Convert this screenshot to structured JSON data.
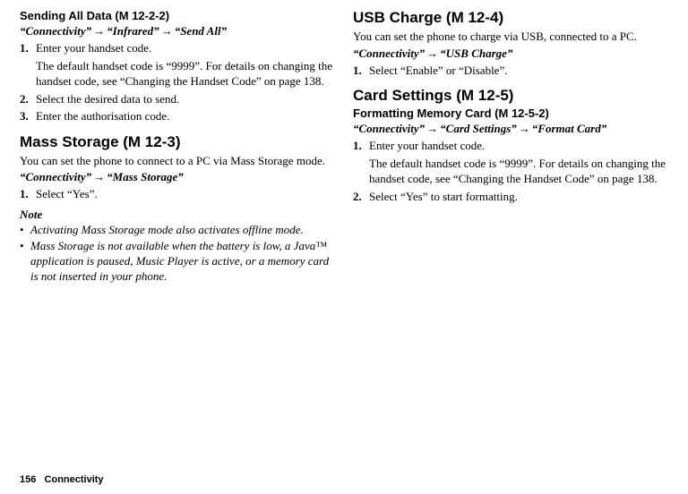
{
  "left": {
    "sec1": {
      "heading": "Sending All Data (M 12-2-2)",
      "nav_parts": [
        "“Connectivity”",
        "“Infrared”",
        "“Send All”"
      ],
      "step1_num": "1.",
      "step1_text": "Enter your handset code.",
      "step1_detail": "The default handset code is “9999”. For details on changing the handset code, see “Changing the Handset Code” on page 138.",
      "step2_num": "2.",
      "step2_text": "Select the desired data to send.",
      "step3_num": "3.",
      "step3_text": "Enter the authorisation code."
    },
    "sec2": {
      "heading": "Mass Storage (M 12-3)",
      "intro": "You can set the phone to connect to a PC via Mass Storage mode.",
      "nav_parts": [
        "“Connectivity”",
        "“Mass Storage”"
      ],
      "step1_num": "1.",
      "step1_text": "Select “Yes”.",
      "note_label": "Note",
      "bullet1": "Activating Mass Storage mode also activates offline mode.",
      "bullet2": "Mass Storage is not available when the battery is low, a Java™ application is paused, Music Player is active, or a memory card is not inserted in your phone."
    }
  },
  "right": {
    "sec1": {
      "heading": "USB Charge (M 12-4)",
      "intro": "You can set the phone to charge via USB, connected to a PC.",
      "nav_parts": [
        "“Connectivity”",
        "“USB Charge”"
      ],
      "step1_num": "1.",
      "step1_text": "Select “Enable” or “Disable”."
    },
    "sec2": {
      "heading": "Card Settings (M 12-5)",
      "sub_heading": "Formatting Memory Card (M 12-5-2)",
      "nav_parts": [
        "“Connectivity”",
        "“Card Settings”",
        "“Format Card”"
      ],
      "step1_num": "1.",
      "step1_text": "Enter your handset code.",
      "step1_detail": "The default handset code is “9999”. For details on changing the handset code, see “Changing the Handset Code” on page 138.",
      "step2_num": "2.",
      "step2_text": "Select “Yes” to start formatting."
    }
  },
  "footer": {
    "page_num": "156",
    "section": "Connectivity"
  }
}
